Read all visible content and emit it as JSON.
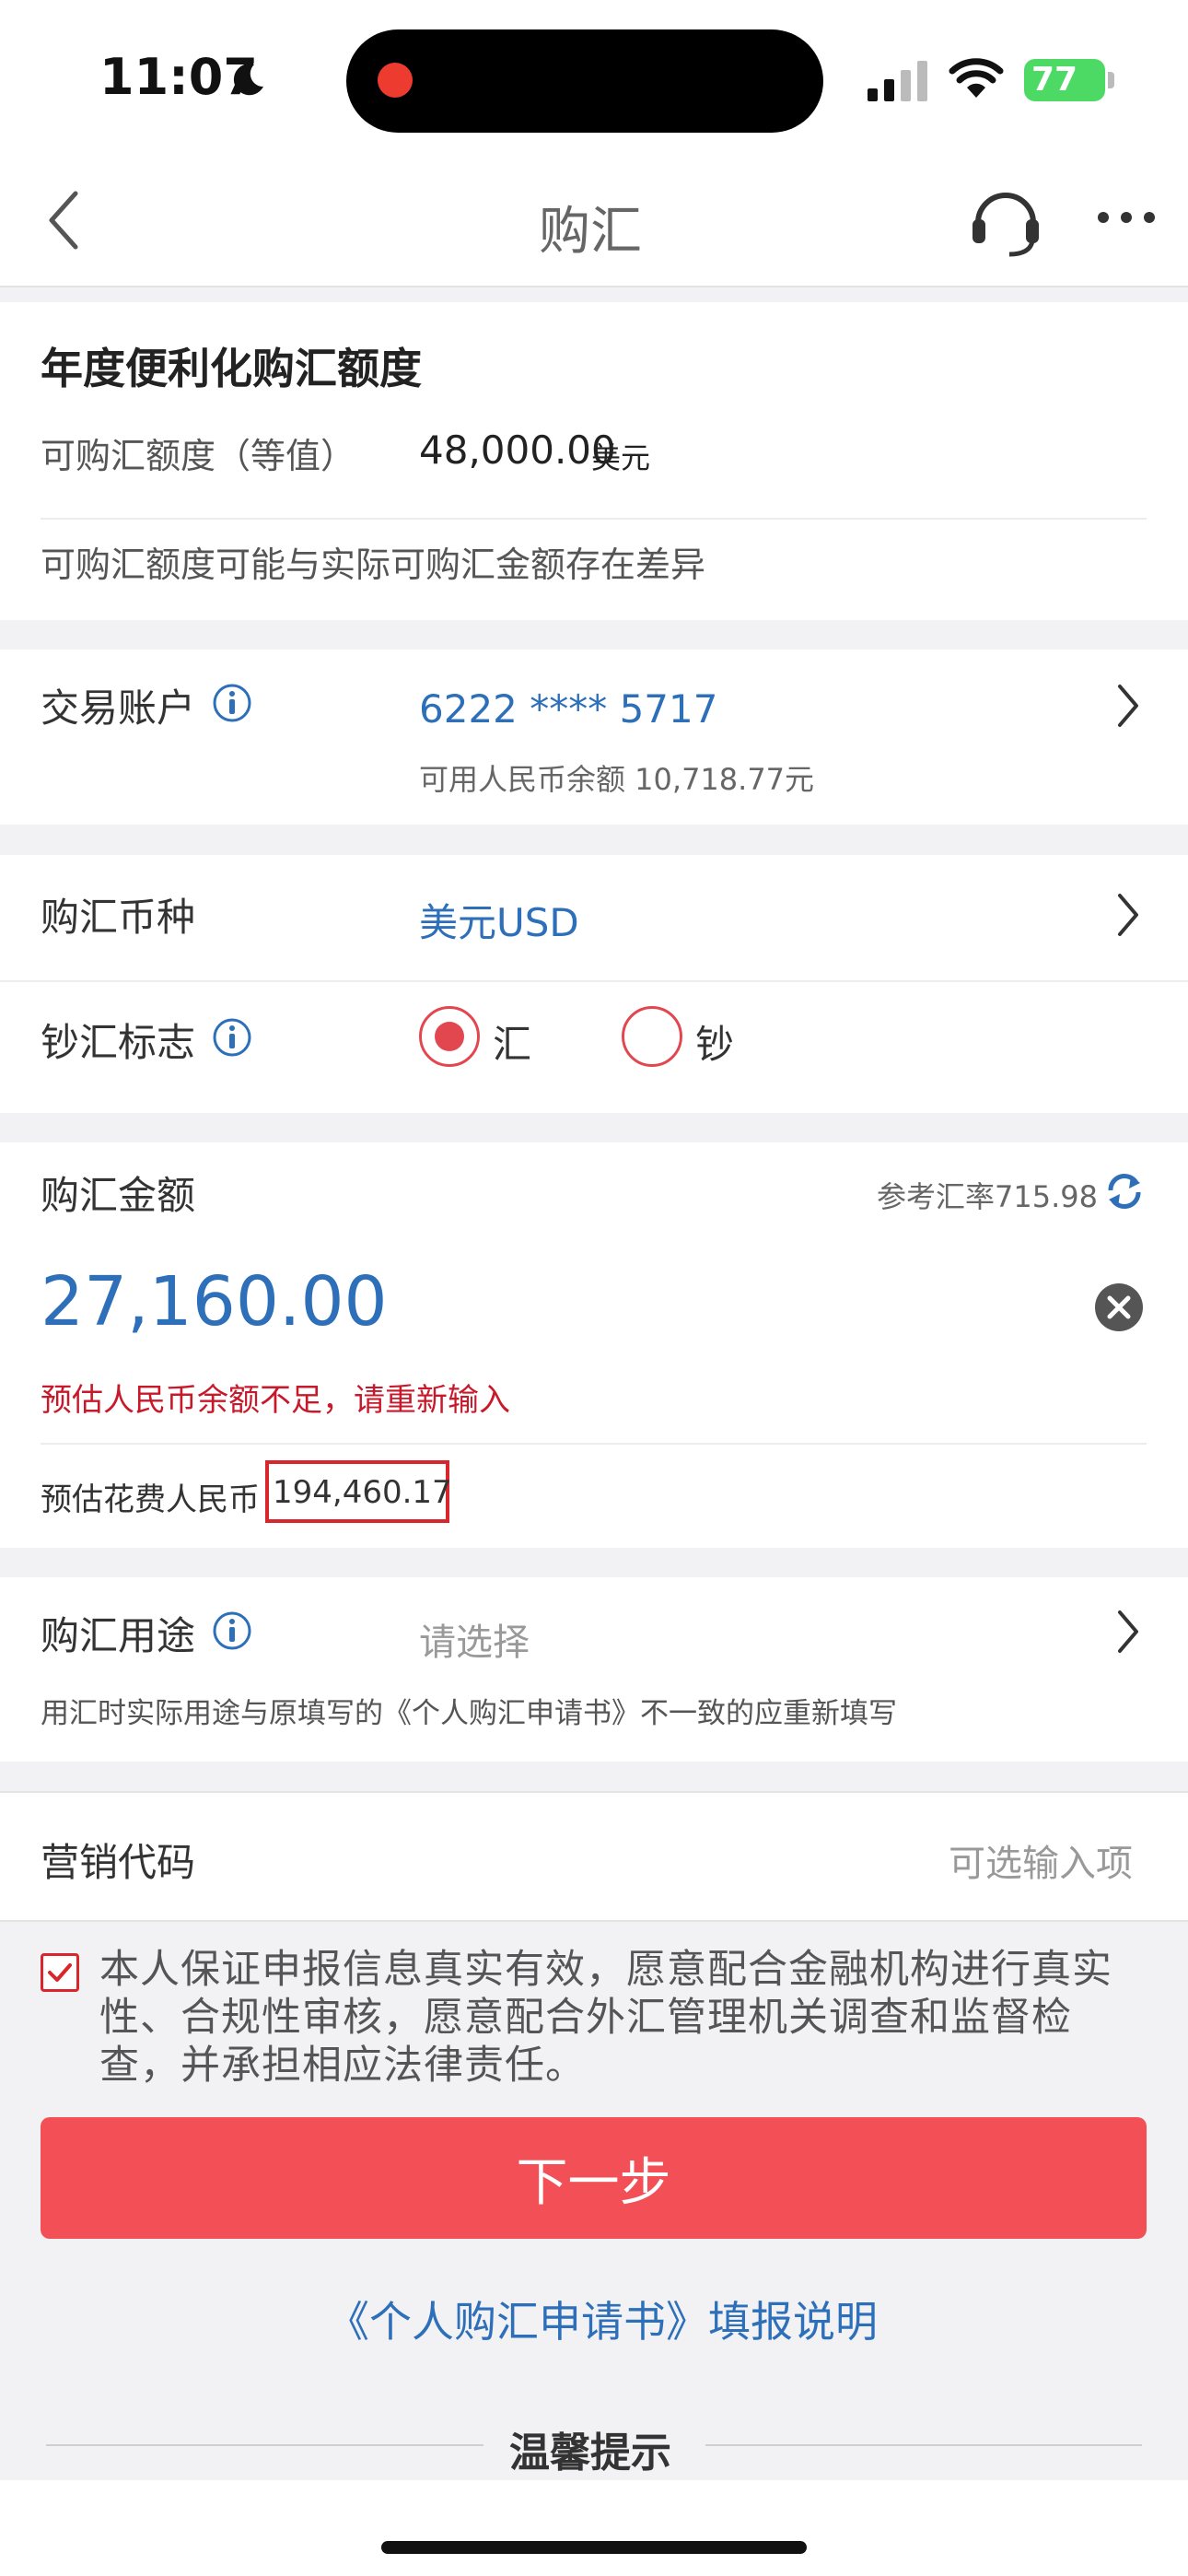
{
  "status_bar": {
    "time": "11:07",
    "battery": "77"
  },
  "nav": {
    "title": "购汇"
  },
  "quota": {
    "title": "年度便利化购汇额度",
    "label": "可购汇额度（等值）",
    "amount": "48,000.00",
    "unit": "美元",
    "note": "可购汇额度可能与实际可购汇金额存在差异"
  },
  "account": {
    "label": "交易账户",
    "number": "6222 **** 5717",
    "balance": "可用人民币余额 10,718.77元"
  },
  "currency": {
    "label": "购汇币种",
    "value": "美元USD"
  },
  "cash_flag": {
    "label": "钞汇标志",
    "options": [
      {
        "label": "汇",
        "selected": true
      },
      {
        "label": "钞",
        "selected": false
      }
    ]
  },
  "amount": {
    "label": "购汇金额",
    "rate_text": "参考汇率715.98",
    "value": "27,160.00",
    "error": "预估人民币余额不足，请重新输入",
    "est_label": "预估花费人民币",
    "est_value": "194,460.17"
  },
  "purpose": {
    "label": "购汇用途",
    "placeholder": "请选择",
    "note": "用汇时实际用途与原填写的《个人购汇申请书》不一致的应重新填写"
  },
  "marketing": {
    "label": "营销代码",
    "placeholder": "可选输入项"
  },
  "agreement": {
    "text": "本人保证申报信息真实有效，愿意配合金融机构进行真实性、合规性审核，愿意配合外汇管理机关调查和监督检查，并承担相应法律责任。",
    "checked": true
  },
  "next_button": {
    "label": "下一步"
  },
  "guide_link": {
    "label": "《个人购汇申请书》填报说明"
  },
  "tips": {
    "title": "温馨提示"
  },
  "colors": {
    "accent_blue": "#2d6fb8",
    "error_red": "#c8192b",
    "button_red": "#f25056"
  }
}
